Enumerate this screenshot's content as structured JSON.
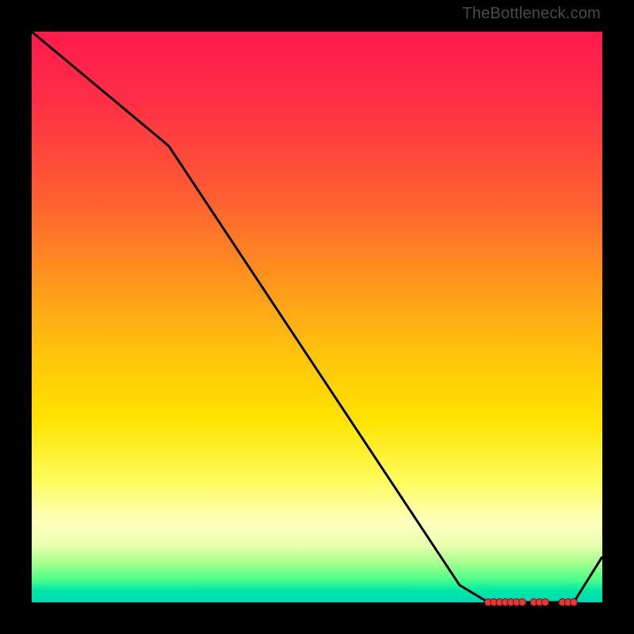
{
  "attribution": "TheBottleneck.com",
  "chart_data": {
    "type": "line",
    "title": "",
    "xlabel": "",
    "ylabel": "",
    "xlim": [
      0,
      100
    ],
    "ylim": [
      0,
      100
    ],
    "x": [
      0,
      12,
      24,
      75,
      80,
      90,
      95,
      100
    ],
    "values": [
      100,
      90,
      80,
      3,
      0,
      0,
      0,
      8
    ],
    "markers": {
      "x": [
        80,
        81,
        82,
        83,
        84,
        85,
        86,
        88,
        89,
        90,
        93,
        94,
        95
      ],
      "values": [
        0,
        0,
        0,
        0,
        0,
        0,
        0,
        0,
        0,
        0,
        0,
        0,
        0
      ]
    },
    "gradient_stops": [
      {
        "pos": 0,
        "color": "#ff1a4d"
      },
      {
        "pos": 12,
        "color": "#ff2e46"
      },
      {
        "pos": 28,
        "color": "#ff5a33"
      },
      {
        "pos": 42,
        "color": "#ff8f1f"
      },
      {
        "pos": 55,
        "color": "#ffbf0d"
      },
      {
        "pos": 68,
        "color": "#ffe300"
      },
      {
        "pos": 78,
        "color": "#fffb55"
      },
      {
        "pos": 86,
        "color": "#ffffbe"
      },
      {
        "pos": 90,
        "color": "#e9ffb0"
      },
      {
        "pos": 93,
        "color": "#a8ff8e"
      },
      {
        "pos": 96,
        "color": "#4dff8a"
      },
      {
        "pos": 98,
        "color": "#00e8a6"
      },
      {
        "pos": 100,
        "color": "#00d8b6"
      }
    ]
  }
}
